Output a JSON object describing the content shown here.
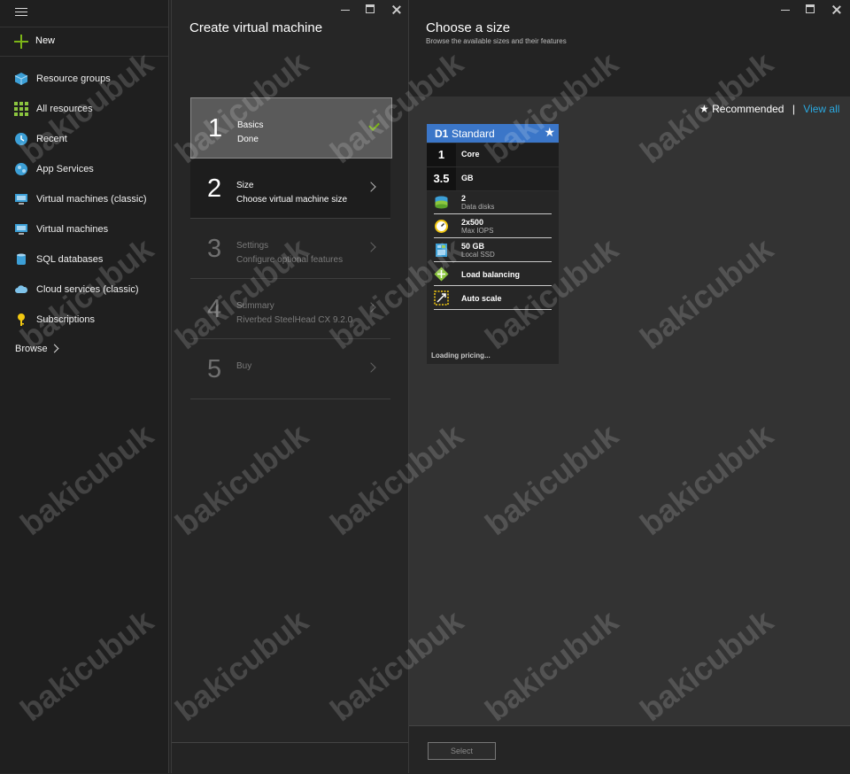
{
  "sidebar": {
    "new_label": "New",
    "items": [
      {
        "label": "Resource groups",
        "icon": "resource-groups-icon"
      },
      {
        "label": "All resources",
        "icon": "all-resources-icon"
      },
      {
        "label": "Recent",
        "icon": "clock-icon"
      },
      {
        "label": "App Services",
        "icon": "app-services-icon"
      },
      {
        "label": "Virtual machines (classic)",
        "icon": "monitor-icon"
      },
      {
        "label": "Virtual machines",
        "icon": "monitor-icon"
      },
      {
        "label": "SQL databases",
        "icon": "database-icon"
      },
      {
        "label": "Cloud services (classic)",
        "icon": "cloud-icon"
      },
      {
        "label": "Subscriptions",
        "icon": "key-icon"
      }
    ],
    "browse_label": "Browse"
  },
  "create_vm": {
    "title": "Create virtual machine",
    "steps": [
      {
        "num": "1",
        "title": "Basics",
        "subtitle": "Done",
        "state": "done"
      },
      {
        "num": "2",
        "title": "Size",
        "subtitle": "Choose virtual machine size",
        "state": "active"
      },
      {
        "num": "3",
        "title": "Settings",
        "subtitle": "Configure optional features",
        "state": "disabled"
      },
      {
        "num": "4",
        "title": "Summary",
        "subtitle": "Riverbed SteelHead CX 9.2.0",
        "state": "disabled"
      },
      {
        "num": "5",
        "title": "Buy",
        "subtitle": "",
        "state": "disabled"
      }
    ]
  },
  "choose_size": {
    "title": "Choose a size",
    "subtitle": "Browse the available sizes and their features",
    "recommended_label": "Recommended",
    "separator": "|",
    "view_all_label": "View all",
    "card": {
      "code": "D1",
      "tier": "Standard",
      "cores_value": "1",
      "cores_unit": "Core",
      "memory_value": "3.5",
      "memory_unit": "GB",
      "features": [
        {
          "value": "2",
          "label": "Data disks",
          "icon": "disk-icon"
        },
        {
          "value": "2x500",
          "label": "Max IOPS",
          "icon": "gauge-icon"
        },
        {
          "value": "50 GB",
          "label": "Local SSD",
          "icon": "ssd-icon"
        },
        {
          "value": "Load balancing",
          "label": "",
          "icon": "load-balancing-icon"
        },
        {
          "value": "Auto scale",
          "label": "",
          "icon": "auto-scale-icon"
        }
      ],
      "loading_text": "Loading pricing..."
    },
    "select_label": "Select"
  },
  "watermark": "bakicubuk",
  "colors": {
    "accent": "#3b76c8",
    "success": "#7cb518",
    "link": "#2ba9e0"
  }
}
